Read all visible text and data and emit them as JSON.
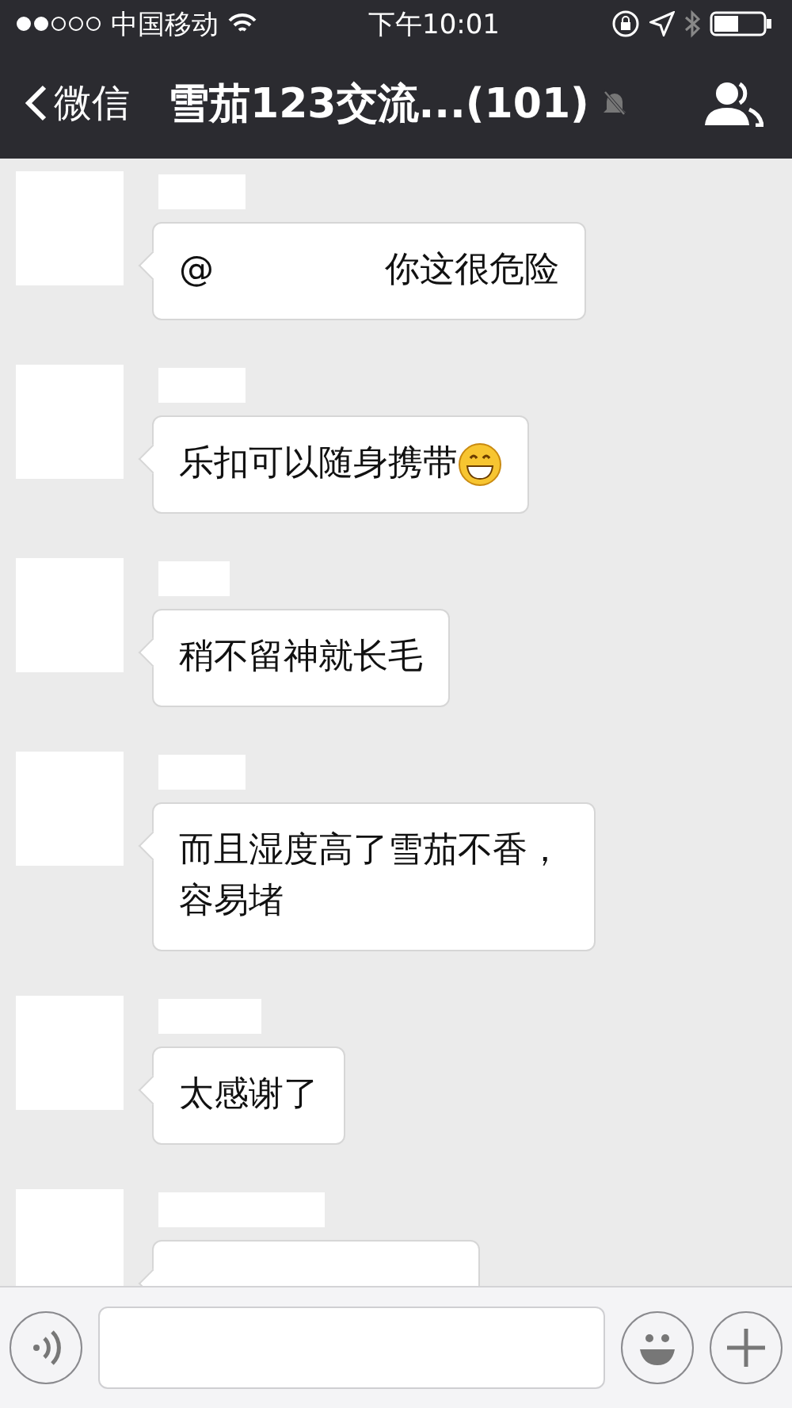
{
  "status_bar": {
    "carrier": "中国移动",
    "time": "下午10:01"
  },
  "nav": {
    "back": "微信",
    "title": "雪茄123交流...(101)",
    "muted": true
  },
  "messages": [
    {
      "kind": "full",
      "parts": [
        {
          "kind": "text",
          "text": "@"
        },
        {
          "kind": "hidden"
        },
        {
          "kind": "text",
          "text": "你这很危险"
        }
      ]
    },
    {
      "kind": "full",
      "parts": [
        {
          "kind": "text",
          "text": "乐扣可以随身携带"
        },
        {
          "kind": "emoji"
        }
      ]
    },
    {
      "kind": "full",
      "parts": [
        {
          "kind": "text",
          "text": "稍不留神就长毛"
        }
      ]
    },
    {
      "kind": "full",
      "parts": [
        {
          "kind": "text",
          "text": "而且湿度高了雪茄不香，容易堵"
        }
      ]
    },
    {
      "kind": "full",
      "parts": [
        {
          "kind": "text",
          "text": "太感谢了"
        }
      ]
    },
    {
      "kind": "cut_off"
    }
  ]
}
